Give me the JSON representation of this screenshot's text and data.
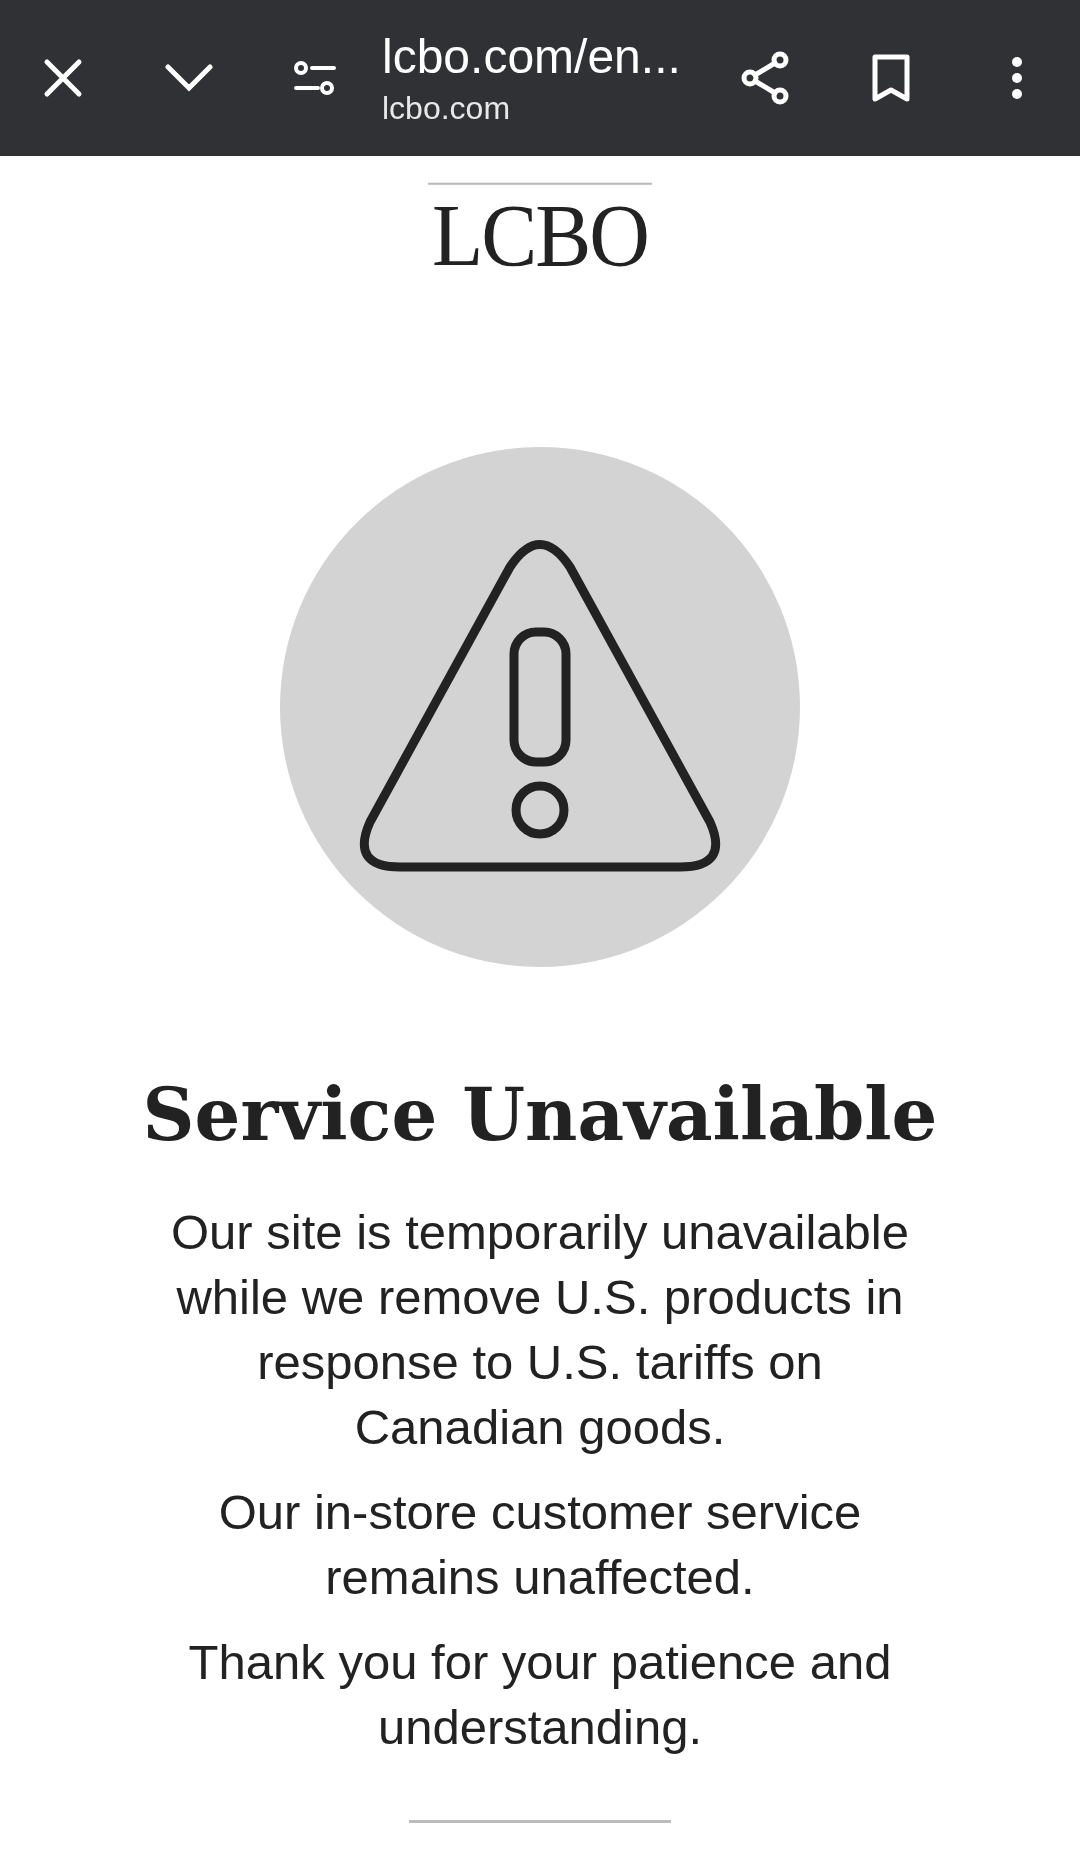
{
  "browser_bar": {
    "title": "lcbo.com/en...",
    "domain": "lcbo.com"
  },
  "logo": "LCBO",
  "heading": "Service Unavailable",
  "paragraphs": [
    "Our site is temporarily unavailable while we remove U.S. products in response to U.S. tariffs on Canadian goods.",
    "Our in-store customer service remains unaffected.",
    "Thank you for your patience and understanding."
  ]
}
